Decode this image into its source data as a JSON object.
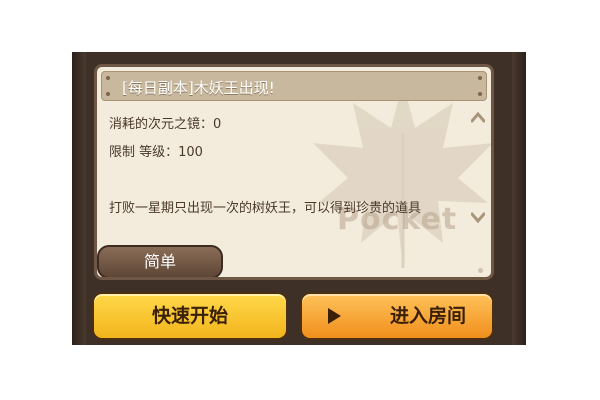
{
  "dungeon": {
    "title": "[每日副本]木妖王出现!",
    "cost_line": "消耗的次元之镜：0",
    "level_line": "限制 等级：100",
    "description": "打败一星期只出现一次的树妖王，可以得到珍贵的道具",
    "watermark": "Pocket"
  },
  "difficulty": {
    "label": "简单"
  },
  "actions": {
    "quick_start_label": "快速开始",
    "enter_room_label": "进入房间"
  },
  "colors": {
    "frame": "#3e3027",
    "panel": "#f3ebdc",
    "quick_start": "#f2b51c",
    "enter_room": "#f08f1c"
  }
}
